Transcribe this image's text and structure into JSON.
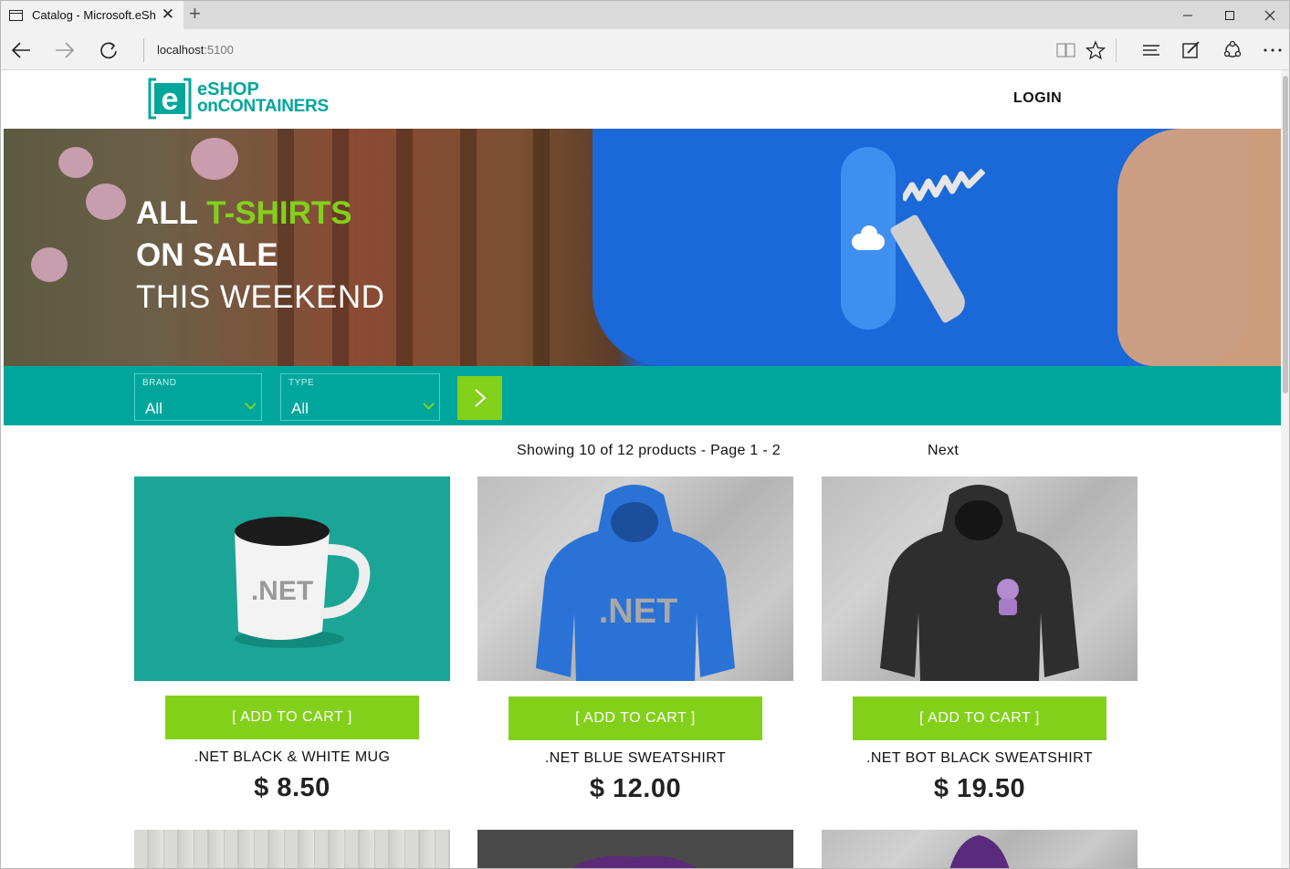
{
  "browser": {
    "tab_title": "Catalog - Microsoft.eSh",
    "url_host": "localhost",
    "url_port": ":5100"
  },
  "header": {
    "logo_line1": "eSHOP",
    "logo_line2": "onCONTAINERS",
    "logo_letter": "e",
    "login_label": "LOGIN"
  },
  "hero": {
    "line1_white": "ALL",
    "line1_accent": "T-SHIRTS",
    "line2": "ON SALE",
    "line3": "THIS WEEKEND"
  },
  "filters": {
    "brand_label": "BRAND",
    "brand_value": "All",
    "type_label": "TYPE",
    "type_value": "All"
  },
  "paging": {
    "summary": "Showing 10 of 12 products - Page 1 - 2",
    "next_label": "Next"
  },
  "products": [
    {
      "name": ".NET BLACK & WHITE MUG",
      "price": "$ 8.50",
      "add_label": "[ ADD TO CART ]",
      "image_text": ".NET"
    },
    {
      "name": ".NET BLUE SWEATSHIRT",
      "price": "$ 12.00",
      "add_label": "[ ADD TO CART ]",
      "image_text": ".NET"
    },
    {
      "name": ".NET BOT BLACK SWEATSHIRT",
      "price": "$ 19.50",
      "add_label": "[ ADD TO CART ]"
    }
  ],
  "colors": {
    "teal": "#00a69c",
    "green": "#83d01b"
  }
}
